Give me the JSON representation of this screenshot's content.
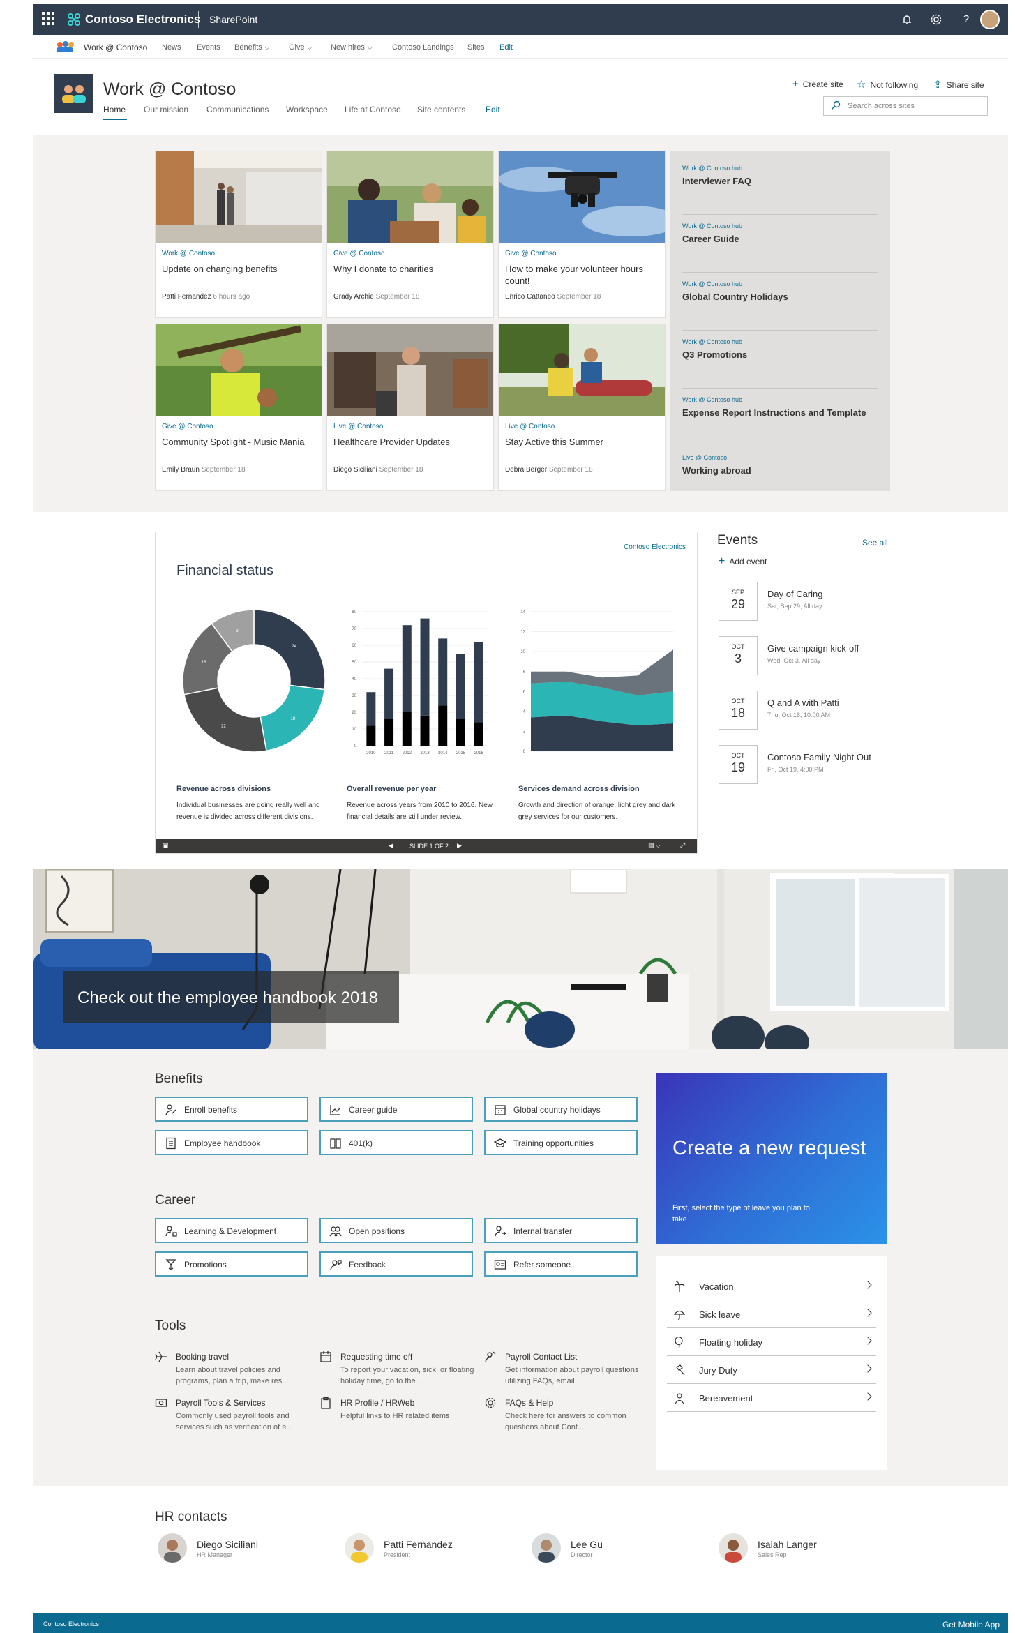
{
  "suite_bar": {
    "brand": "Contoso Electronics",
    "app": "SharePoint",
    "icons": [
      "waffle-icon",
      "bell-icon",
      "gear-icon",
      "help-icon"
    ]
  },
  "hub_nav": {
    "hub_name": "Work @ Contoso",
    "items": [
      "News",
      "Events",
      "Benefits",
      "Give",
      "New hires",
      "Contoso Landings",
      "Sites"
    ],
    "edit": "Edit"
  },
  "site": {
    "title": "Work @ Contoso",
    "nav": [
      "Home",
      "Our mission",
      "Communications",
      "Workspace",
      "Life at Contoso",
      "Site contents"
    ],
    "nav_edit": "Edit",
    "actions": {
      "create": "Create site",
      "follow": "Not following",
      "share": "Share site"
    },
    "search_placeholder": "Search across sites"
  },
  "news": [
    {
      "category": "Work @ Contoso",
      "title": "Update on changing benefits",
      "author": "Patti Fernandez",
      "when": "6 hours ago"
    },
    {
      "category": "Give @ Contoso",
      "title": "Why I donate to charities",
      "author": "Grady Archie",
      "when": "September 18"
    },
    {
      "category": "Give @ Contoso",
      "title": "How to make your volunteer hours count!",
      "author": "Enrico Cattaneo",
      "when": "September 18"
    },
    {
      "category": "Give @ Contoso",
      "title": "Community Spotlight - Music Mania",
      "author": "Emily Braun",
      "when": "September 18"
    },
    {
      "category": "Live @ Contoso",
      "title": "Healthcare Provider Updates",
      "author": "Diego Siciliani",
      "when": "September 18"
    },
    {
      "category": "Live @ Contoso",
      "title": "Stay Active this Summer",
      "author": "Debra Berger",
      "when": "September 18"
    }
  ],
  "hub_news": [
    {
      "category": "Work @ Contoso hub",
      "title": "Interviewer FAQ"
    },
    {
      "category": "Work @ Contoso hub",
      "title": "Career Guide"
    },
    {
      "category": "Work @ Contoso hub",
      "title": "Global Country Holidays"
    },
    {
      "category": "Work @ Contoso hub",
      "title": "Q3 Promotions"
    },
    {
      "category": "Work @ Contoso hub",
      "title": "Expense Report Instructions and Template"
    },
    {
      "category": "Live @ Contoso",
      "title": "Working abroad"
    }
  ],
  "financial": {
    "title": "Financial status",
    "logo_text": "Contoso Electronics",
    "captions": [
      {
        "heading": "Revenue across divisions",
        "text": "Individual businesses are going really well and revenue is divided across different divisions."
      },
      {
        "heading": "Overall revenue per year",
        "text": "Revenue across years from 2010 to 2016. New financial details are still under review."
      },
      {
        "heading": "Services demand across division",
        "text": "Growth and direction of orange, light grey and dark grey services for our customers."
      }
    ],
    "slide_text": "SLIDE 1 OF 2"
  },
  "chart_data": [
    {
      "type": "pie",
      "variant": "donut",
      "title": "",
      "labels": [
        "24",
        "18",
        "22",
        "16",
        "9"
      ],
      "values": [
        24,
        18,
        22,
        16,
        9
      ],
      "colors": [
        "#2f3d4f",
        "#2bb5b5",
        "#4a4a4a",
        "#6b6b6b",
        "#a0a0a0"
      ]
    },
    {
      "type": "bar",
      "stacked": true,
      "categories": [
        "2010",
        "2011",
        "2012",
        "2013",
        "2014",
        "2015",
        "2016"
      ],
      "series": [
        {
          "values": [
            12,
            16,
            20,
            18,
            24,
            16,
            14
          ]
        },
        {
          "values": [
            20,
            30,
            52,
            58,
            40,
            39,
            48
          ]
        }
      ],
      "ylim": [
        0,
        80
      ],
      "yticks": [
        "0",
        "10",
        "20",
        "30",
        "40",
        "50",
        "60",
        "70",
        "80"
      ],
      "colors": [
        "#000000",
        "#2f3d4f"
      ]
    },
    {
      "type": "area",
      "stacked": true,
      "x": [
        0,
        1,
        2,
        3,
        4
      ],
      "series": [
        {
          "values": [
            3.4,
            3.6,
            3.0,
            2.6,
            2.8
          ]
        },
        {
          "values": [
            3.4,
            3.4,
            3.4,
            3.0,
            3.2
          ]
        },
        {
          "values": [
            1.2,
            1.0,
            1.0,
            2.0,
            4.2
          ]
        }
      ],
      "ylim": [
        0,
        14
      ],
      "yticks": [
        "0",
        "2",
        "4",
        "6",
        "8",
        "10",
        "12",
        "14"
      ],
      "colors": [
        "#2f3d4f",
        "#2bb5b5",
        "#6a737b"
      ]
    }
  ],
  "events": {
    "title": "Events",
    "see_all": "See all",
    "add": "Add event",
    "items": [
      {
        "month": "SEP",
        "day": "29",
        "title": "Day of Caring",
        "sub": "Sat, Sep 29, All day"
      },
      {
        "month": "OCT",
        "day": "3",
        "title": "Give campaign kick-off",
        "sub": "Wed, Oct 3, All day"
      },
      {
        "month": "OCT",
        "day": "18",
        "title": "Q and A with Patti",
        "sub": "Thu, Oct 18, 10:00 AM"
      },
      {
        "month": "OCT",
        "day": "19",
        "title": "Contoso Family Night Out",
        "sub": "Fri, Oct 19, 4:00 PM"
      }
    ]
  },
  "hero": {
    "caption": "Check out the employee handbook 2018"
  },
  "benefits": {
    "title": "Benefits",
    "links": [
      "Enroll benefits",
      "Career guide",
      "Global country holidays",
      "Employee handbook",
      "401(k)",
      "Training opportunities"
    ]
  },
  "career": {
    "title": "Career",
    "links": [
      "Learning & Development",
      "Open positions",
      "Internal transfer",
      "Promotions",
      "Feedback",
      "Refer someone"
    ]
  },
  "tools": {
    "title": "Tools",
    "items": [
      {
        "title": "Booking travel",
        "desc": "Learn about travel policies and programs, plan a trip, make res..."
      },
      {
        "title": "Requesting time off",
        "desc": "To report your vacation, sick, or floating holiday time, go to the ..."
      },
      {
        "title": "Payroll Contact List",
        "desc": "Get information about payroll questions utilizing FAQs, email ..."
      },
      {
        "title": "Payroll Tools & Services",
        "desc": "Commonly used payroll tools and services such as verification of e..."
      },
      {
        "title": "HR Profile / HRWeb",
        "desc": "Helpful links to HR related items"
      },
      {
        "title": "FAQs & Help",
        "desc": "Check here for answers to common questions about Cont..."
      }
    ]
  },
  "request": {
    "title": "Create a new request",
    "desc": "First, select the type of leave you plan to take",
    "options": [
      "Vacation",
      "Sick leave",
      "Floating holiday",
      "Jury Duty",
      "Bereavement"
    ]
  },
  "contacts": {
    "title": "HR contacts",
    "people": [
      {
        "name": "Diego Siciliani",
        "role": "HR Manager"
      },
      {
        "name": "Patti Fernandez",
        "role": "President"
      },
      {
        "name": "Lee Gu",
        "role": "Director"
      },
      {
        "name": "Isaiah Langer",
        "role": "Sales Rep"
      }
    ]
  },
  "footer": {
    "left": "Contoso Electronics",
    "right": "Get Mobile App"
  }
}
